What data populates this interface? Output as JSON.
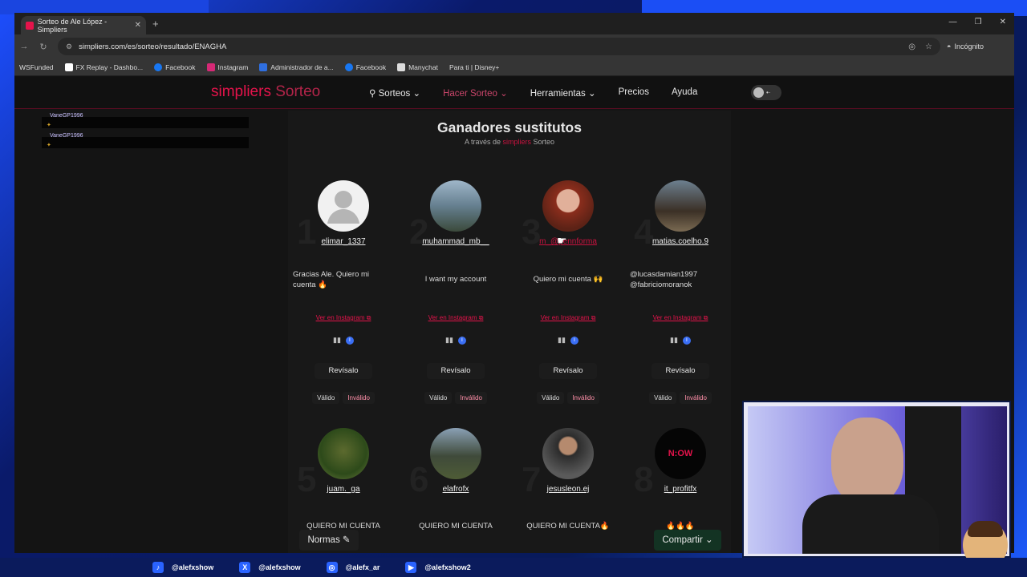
{
  "browser": {
    "tab_title": "Sorteo de Ale López - Simpliers",
    "url": "simpliers.com/es/sorteo/resultado/ENAGHA",
    "incognito_label": "Incógnito",
    "bookmarks": [
      "WSFunded",
      "FX Replay - Dashbo...",
      "Facebook",
      "Instagram",
      "Administrador de a...",
      "Facebook",
      "Manychat",
      "Para ti | Disney+"
    ]
  },
  "site": {
    "logo_main": "simpliers",
    "logo_sub": "Sorteo",
    "menu": [
      "Sorteos",
      "Hacer Sorteo",
      "Herramientas",
      "Precios",
      "Ayuda"
    ]
  },
  "sidebar": {
    "entries": [
      {
        "name": "VaneGP1996"
      },
      {
        "name": "VaneGP1996"
      }
    ]
  },
  "panel": {
    "title": "Ganadores sustitutos",
    "subtitle_prefix": "A través de",
    "subtitle_brand": "simpliers",
    "subtitle_suffix": "Sorteo",
    "ig_link": "Ver en Instagram",
    "revisalo": "Revísalo",
    "valido": "Válido",
    "invalido": "Inválido",
    "winners": [
      {
        "rank": "1",
        "username": "elimar_1337",
        "comment": "Gracias Ale. Quiero mi cuenta 🔥"
      },
      {
        "rank": "2",
        "username": "muhammad_mb__",
        "comment": "I want my account"
      },
      {
        "rank": "3",
        "username": "m_@pennforma",
        "comment": "Quiero mi cuenta 🙌"
      },
      {
        "rank": "4",
        "username": "matias.coelho.9",
        "comment": "@lucasdamian1997 @fabriciomoranok"
      },
      {
        "rank": "5",
        "username": "juam._ga",
        "comment": "QUIERO MI CUENTA"
      },
      {
        "rank": "6",
        "username": "elafrofx",
        "comment": "QUIERO MI CUENTA"
      },
      {
        "rank": "7",
        "username": "jesusleon.ej",
        "comment": "QUIERO MI CUENTA🔥"
      },
      {
        "rank": "8",
        "username": "it_profitfx",
        "comment": "🔥🔥🔥",
        "avatar_text": "N:OW"
      }
    ],
    "normas": "Normas",
    "compartir": "Compartir"
  },
  "socials": [
    "@alefxshow",
    "@alefxshow",
    "@alefx_ar",
    "@alefxshow2"
  ],
  "colors": {
    "brand": "#e5134b",
    "accent_blue": "#3b6ff5"
  }
}
